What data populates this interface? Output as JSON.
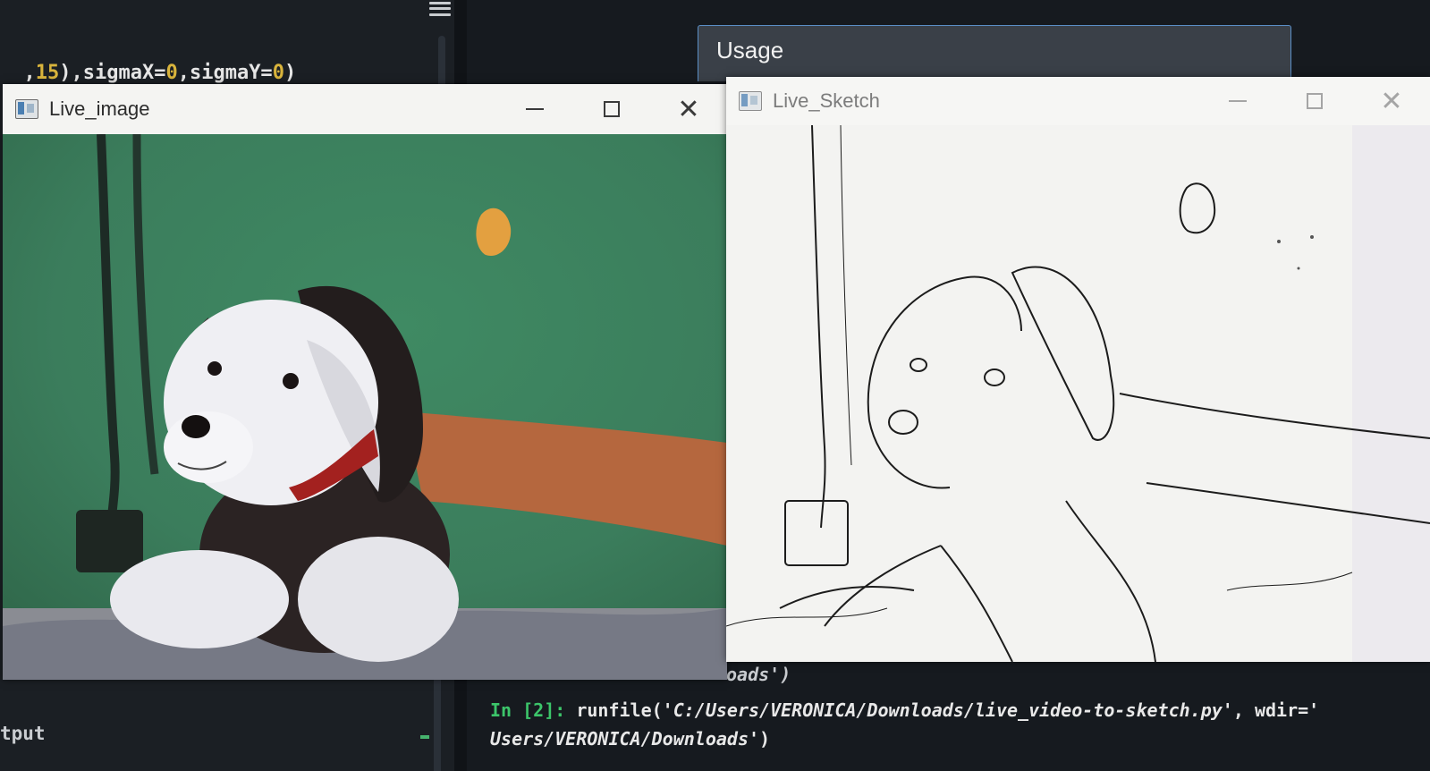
{
  "editor": {
    "code_tokens": [
      {
        "text": ",",
        "kind": "op"
      },
      {
        "text": "15",
        "kind": "num"
      },
      {
        "text": "),sigmaX=",
        "kind": "id"
      },
      {
        "text": "0",
        "kind": "num"
      },
      {
        "text": ",sigmaY=",
        "kind": "id"
      },
      {
        "text": "0",
        "kind": "num"
      },
      {
        "text": ")",
        "kind": "op"
      }
    ],
    "output_label": "tput"
  },
  "usage_panel": {
    "title": "Usage"
  },
  "windows": {
    "live_image": {
      "title": "Live_image",
      "controls": {
        "minimize": "—",
        "maximize": "□",
        "close": "✕"
      }
    },
    "live_sketch": {
      "title": "Live_Sketch",
      "controls": {
        "minimize": "—",
        "maximize": "□",
        "close": "✕"
      }
    }
  },
  "console": {
    "behind_text": "oads')",
    "prompt": "In [2]:",
    "function": "runfile(",
    "path_arg": "'C:/Users/VERONICA/Downloads/live_video-to-sketch.py'",
    "separator": ",",
    "kw_arg": "wdir='",
    "line2_arg": "Users/VERONICA/Downloads'",
    "line2_close": ")"
  },
  "colors": {
    "prompt_green": "#3cc56a",
    "number_yellow": "#d9b43c",
    "usage_border": "#5b8fc7",
    "video_background_green": "#3f8a63"
  },
  "icons": {
    "editor_menu": "hamburger-menu-icon",
    "window_app": "opencv-window-icon"
  }
}
